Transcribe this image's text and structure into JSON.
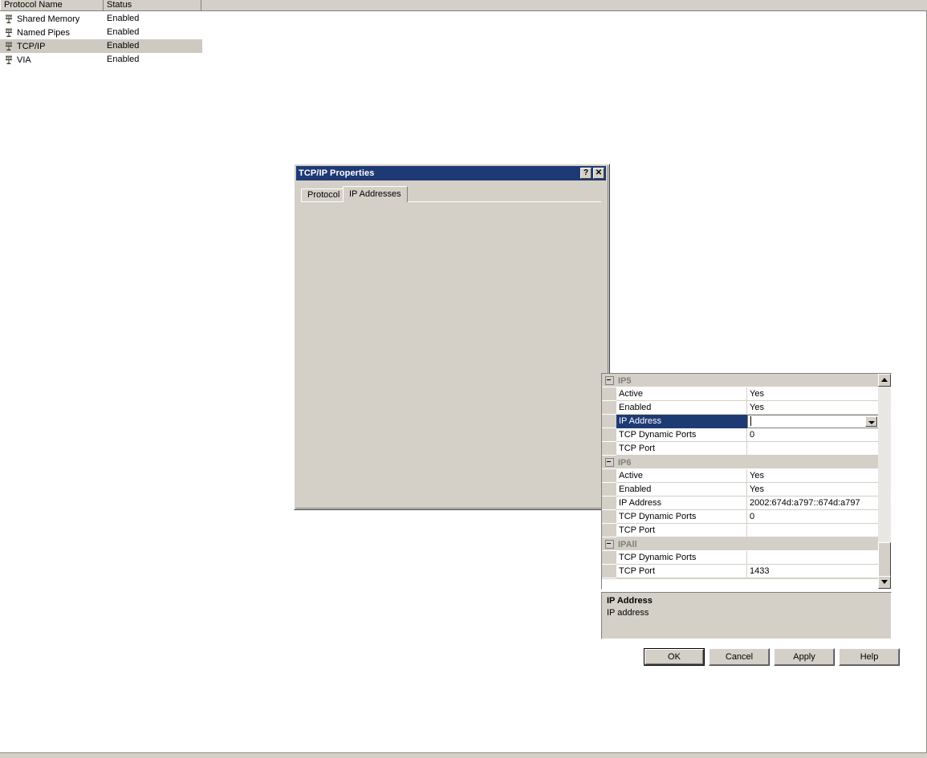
{
  "protocol_list": {
    "columns": [
      "Protocol Name",
      "Status",
      ""
    ],
    "rows": [
      {
        "name": "Shared Memory",
        "status": "Enabled",
        "icon": "network-protocol-icon",
        "selected": false
      },
      {
        "name": "Named Pipes",
        "status": "Enabled",
        "icon": "network-protocol-icon",
        "selected": false
      },
      {
        "name": "TCP/IP",
        "status": "Enabled",
        "icon": "network-protocol-icon",
        "selected": true
      },
      {
        "name": "VIA",
        "status": "Enabled",
        "icon": "network-protocol-icon",
        "selected": false
      }
    ]
  },
  "dialog": {
    "title": "TCP/IP Properties",
    "titlebar_buttons": [
      {
        "glyph": "?",
        "name": "help-button"
      },
      {
        "glyph": "✕",
        "name": "close-button"
      }
    ],
    "tabs": [
      {
        "label": "Protocol",
        "active": false
      },
      {
        "label": "IP Addresses",
        "active": true
      }
    ],
    "grid": {
      "groups": [
        {
          "label": "IP5",
          "rows": [
            {
              "name": "Active",
              "value": "Yes"
            },
            {
              "name": "Enabled",
              "value": "Yes"
            },
            {
              "name": "IP Address",
              "value": "",
              "selected": true,
              "editing": true,
              "has_dropdown": true
            },
            {
              "name": "TCP Dynamic Ports",
              "value": "0"
            },
            {
              "name": "TCP Port",
              "value": ""
            }
          ]
        },
        {
          "label": "IP6",
          "rows": [
            {
              "name": "Active",
              "value": "Yes"
            },
            {
              "name": "Enabled",
              "value": "Yes"
            },
            {
              "name": "IP Address",
              "value": "2002:674d:a797::674d:a797"
            },
            {
              "name": "TCP Dynamic Ports",
              "value": "0"
            },
            {
              "name": "TCP Port",
              "value": ""
            }
          ]
        },
        {
          "label": "IPAll",
          "rows": [
            {
              "name": "TCP Dynamic Ports",
              "value": ""
            },
            {
              "name": "TCP Port",
              "value": "1433"
            }
          ]
        }
      ]
    },
    "description": {
      "title": "IP Address",
      "text": "IP address"
    },
    "buttons": [
      {
        "label": "OK",
        "default": true
      },
      {
        "label": "Cancel",
        "default": false
      },
      {
        "label": "Apply",
        "default": false
      },
      {
        "label": "Help",
        "default": false
      }
    ]
  },
  "colors": {
    "face": "#d4d0c8",
    "titlebar": "#1e3a75",
    "selection": "#1e3a75",
    "row_selected": "#cec9c1",
    "group_text": "#808080"
  }
}
